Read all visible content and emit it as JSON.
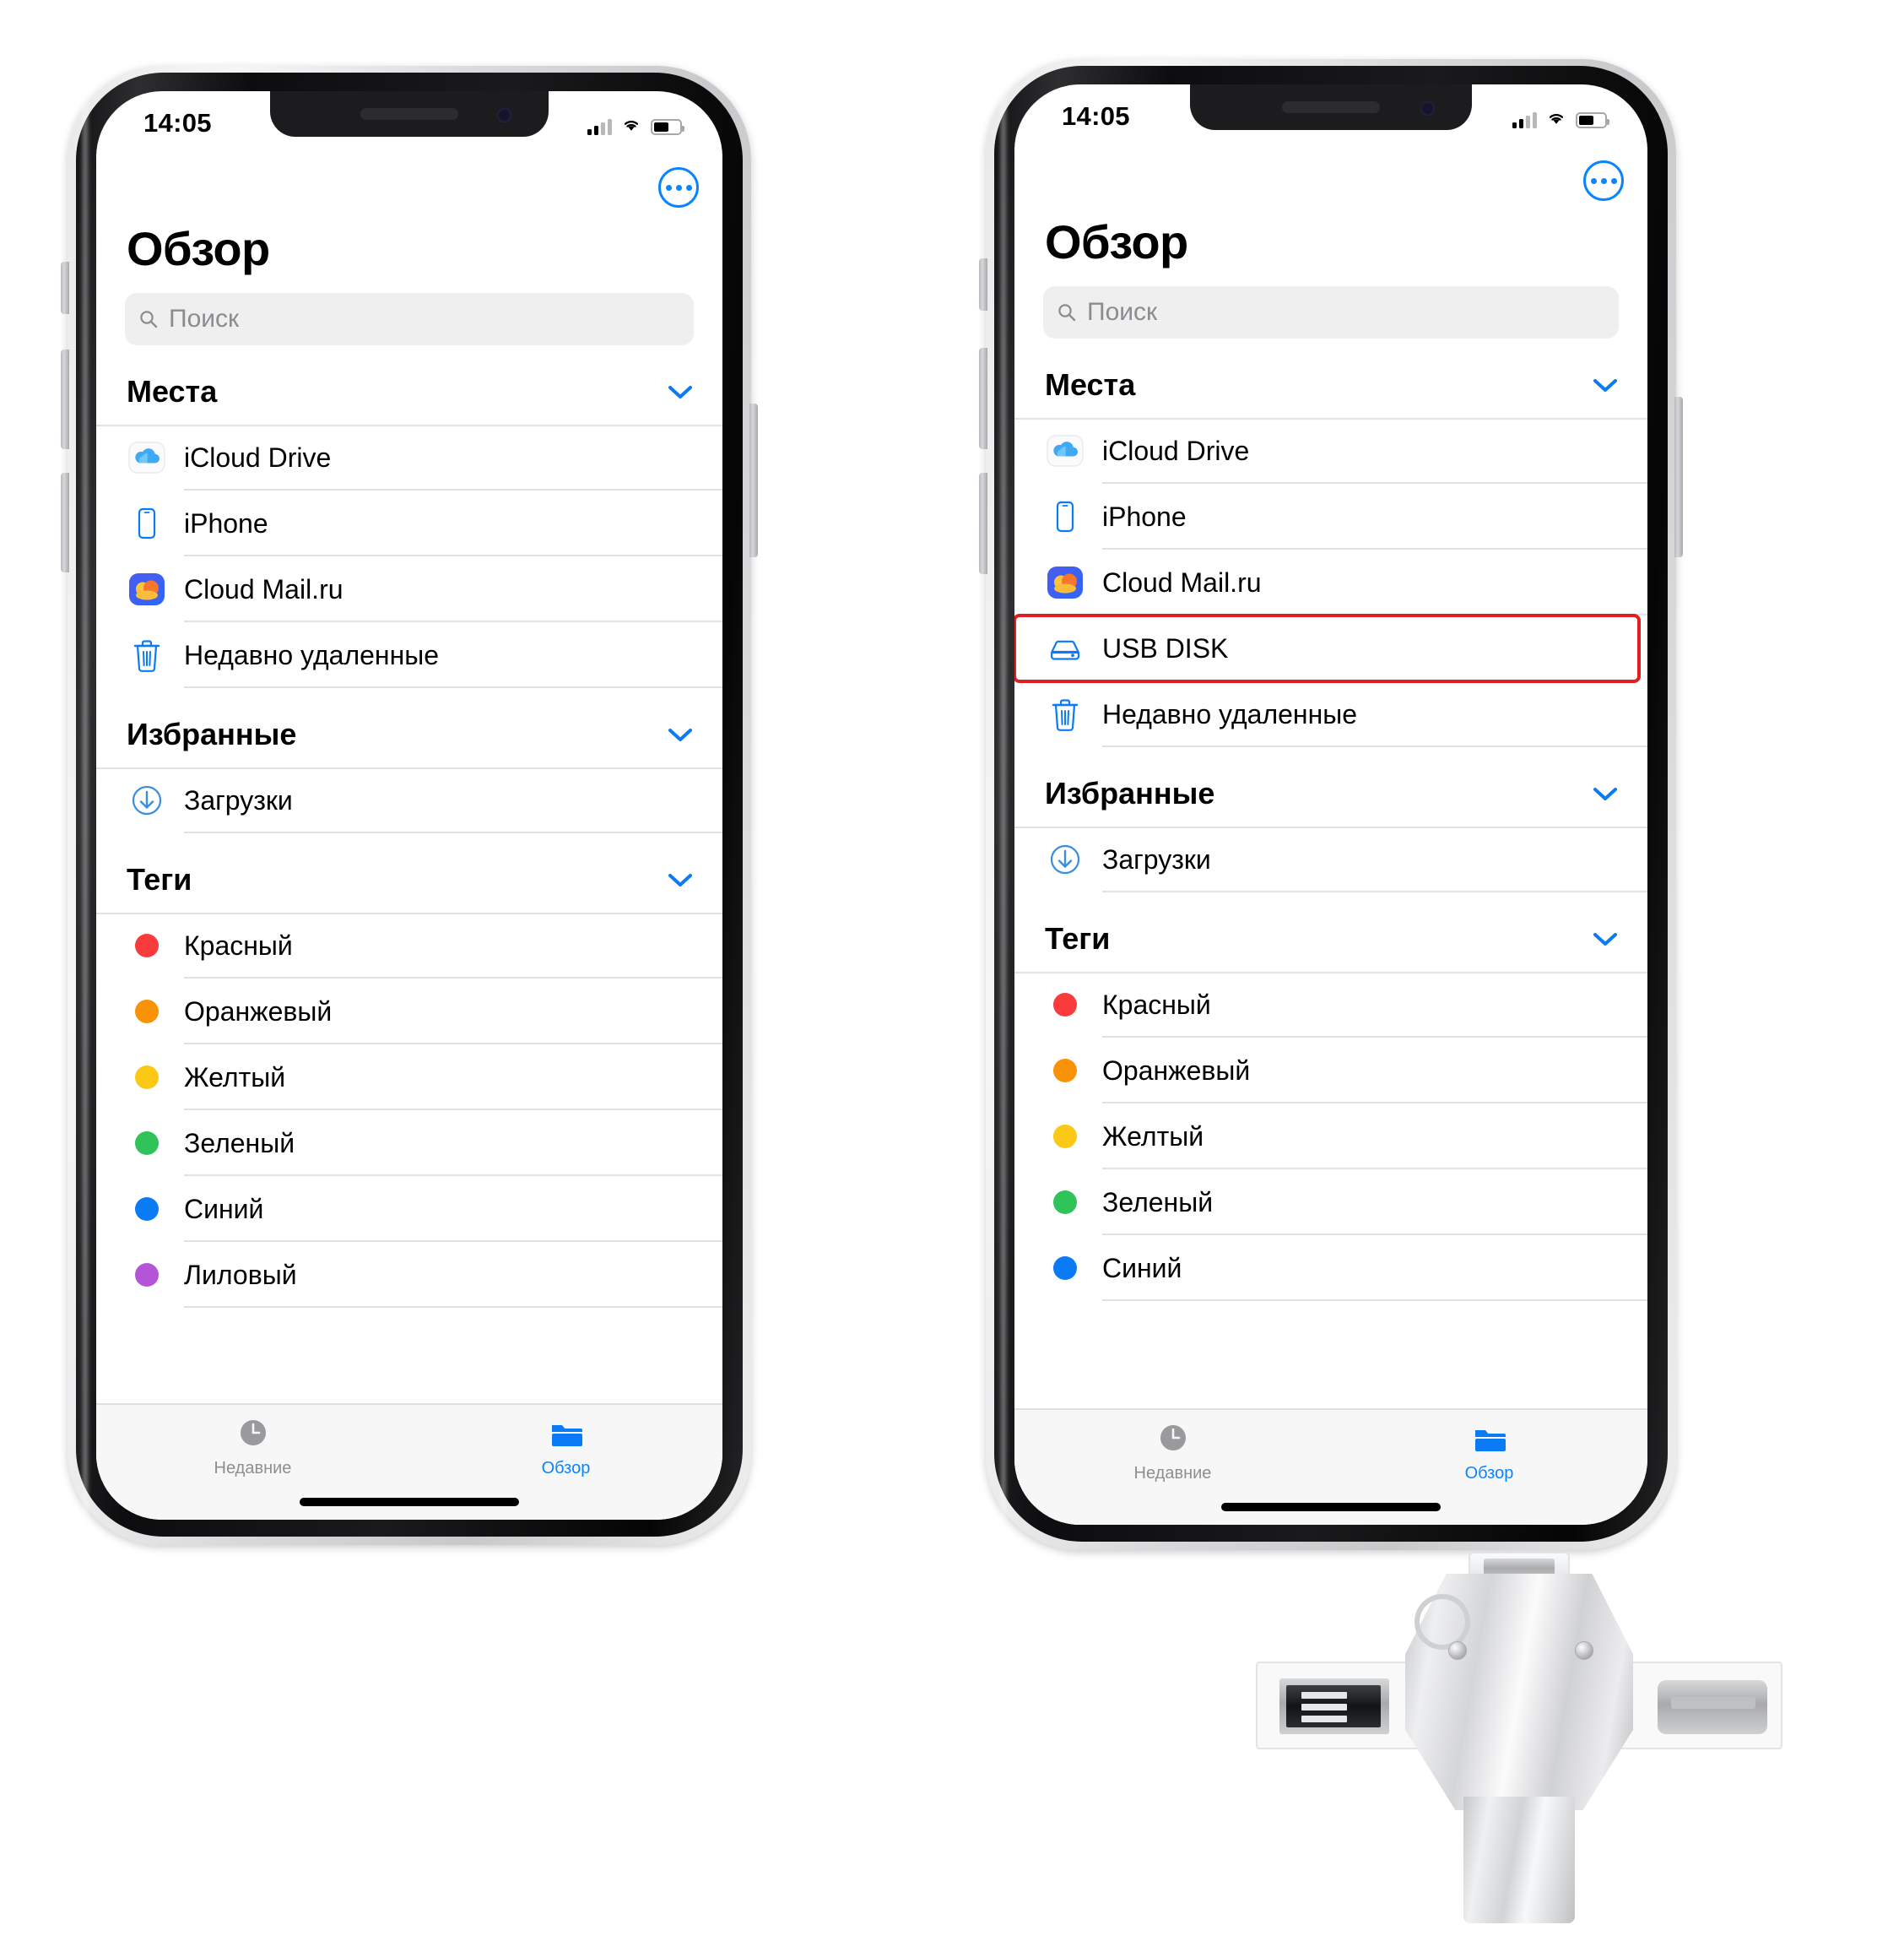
{
  "status_bar": {
    "time": "14:05",
    "signal_icon": "cellular-bars-icon",
    "wifi_icon": "wifi-icon",
    "battery_icon": "battery-icon"
  },
  "app": {
    "title": "Обзор",
    "more_button_label": "•••",
    "search": {
      "placeholder": "Поиск",
      "value": "",
      "icon": "search-icon"
    }
  },
  "colors": {
    "accent": "#0a84ff",
    "highlight": "#e02020",
    "separator": "#e2e2e4",
    "search_bg": "#efeff0",
    "tab_inactive": "#8e8e93"
  },
  "sections": {
    "places": {
      "label": "Места",
      "chevron": "chevron-down-icon"
    },
    "favorites": {
      "label": "Избранные",
      "chevron": "chevron-down-icon"
    },
    "tags": {
      "label": "Теги",
      "chevron": "chevron-down-icon"
    }
  },
  "left_phone": {
    "places_items": [
      {
        "label": "iCloud Drive",
        "icon": "icloud-drive-icon"
      },
      {
        "label": "iPhone",
        "icon": "iphone-icon"
      },
      {
        "label": "Cloud Mail.ru",
        "icon": "cloud-mail-ru-icon"
      },
      {
        "label": "Недавно удаленные",
        "icon": "trash-icon"
      }
    ],
    "favorites_items": [
      {
        "label": "Загрузки",
        "icon": "download-circle-icon"
      }
    ],
    "tags_items": [
      {
        "label": "Красный",
        "color": "#f93b3b"
      },
      {
        "label": "Оранжевый",
        "color": "#f99207"
      },
      {
        "label": "Желтый",
        "color": "#fcc816"
      },
      {
        "label": "Зеленый",
        "color": "#2fc35a"
      },
      {
        "label": "Синий",
        "color": "#0a7bf5"
      },
      {
        "label": "Лиловый",
        "color": "#b455d8"
      }
    ]
  },
  "right_phone": {
    "places_items": [
      {
        "label": "iCloud Drive",
        "icon": "icloud-drive-icon"
      },
      {
        "label": "iPhone",
        "icon": "iphone-icon"
      },
      {
        "label": "Cloud Mail.ru",
        "icon": "cloud-mail-ru-icon"
      },
      {
        "label": "USB DISK",
        "icon": "external-drive-icon",
        "highlighted": true
      },
      {
        "label": "Недавно удаленные",
        "icon": "trash-icon"
      }
    ],
    "favorites_items": [
      {
        "label": "Загрузки",
        "icon": "download-circle-icon"
      }
    ],
    "tags_items": [
      {
        "label": "Красный",
        "color": "#f93b3b"
      },
      {
        "label": "Оранжевый",
        "color": "#f99207"
      },
      {
        "label": "Желтый",
        "color": "#fcc816"
      },
      {
        "label": "Зеленый",
        "color": "#2fc35a"
      },
      {
        "label": "Синий",
        "color": "#0a7bf5"
      }
    ]
  },
  "tab_bar": {
    "tabs": [
      {
        "label": "Недавние",
        "icon": "clock-icon",
        "active": false
      },
      {
        "label": "Обзор",
        "icon": "folder-icon",
        "active": true
      }
    ]
  },
  "usb_drive": {
    "description": "4-in-1 metal cross USB flash drive",
    "connectors": [
      "micro-usb",
      "usb-c",
      "usb-a",
      "lightning"
    ]
  }
}
